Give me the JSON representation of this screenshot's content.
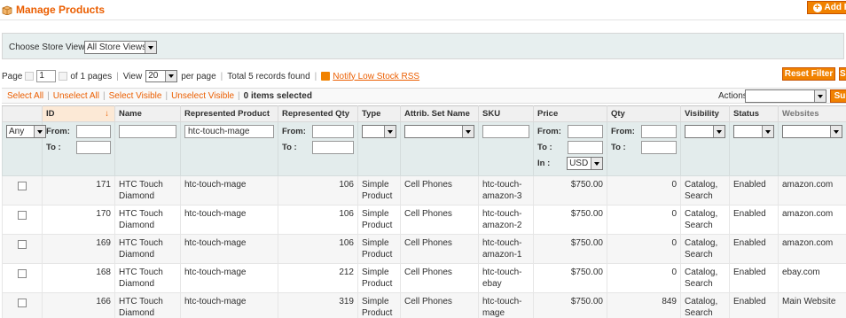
{
  "header": {
    "title": "Manage Products",
    "add_label": "Add P"
  },
  "store": {
    "label": "Choose Store View:",
    "selected": "All Store Views"
  },
  "pager": {
    "page_label": "Page",
    "page_value": "1",
    "of_pages": "of 1 pages",
    "view_label": "View",
    "per_page_value": "20",
    "per_page_label": "per page",
    "total": "Total 5 records found",
    "rss_label": "Notify Low Stock RSS",
    "reset_label": "Reset Filter",
    "search_label": "Se"
  },
  "mass": {
    "select_all": "Select All",
    "unselect_all": "Unselect All",
    "select_visible": "Select Visible",
    "unselect_visible": "Unselect Visible",
    "selected_count": "0 items selected",
    "actions_label": "Actions",
    "submit_label": "Su"
  },
  "columns": {
    "id": "ID",
    "name": "Name",
    "represented_product": "Represented Product",
    "represented_qty": "Represented Qty",
    "type": "Type",
    "attrib_set": "Attrib. Set Name",
    "sku": "SKU",
    "price": "Price",
    "qty": "Qty",
    "visibility": "Visibility",
    "status": "Status",
    "websites": "Websites"
  },
  "filters": {
    "any": "Any",
    "from": "From:",
    "to": "To :",
    "in": "In :",
    "represented_product_value": "htc-touch-mage",
    "currency": "USD"
  },
  "rows": [
    {
      "id": "171",
      "name": "HTC Touch Diamond",
      "rep_product": "htc-touch-mage",
      "rep_qty": "106",
      "type": "Simple Product",
      "attrib": "Cell Phones",
      "sku": "htc-touch-amazon-3",
      "price": "$750.00",
      "qty": "0",
      "visibility": "Catalog, Search",
      "status": "Enabled",
      "websites": "amazon.com"
    },
    {
      "id": "170",
      "name": "HTC Touch Diamond",
      "rep_product": "htc-touch-mage",
      "rep_qty": "106",
      "type": "Simple Product",
      "attrib": "Cell Phones",
      "sku": "htc-touch-amazon-2",
      "price": "$750.00",
      "qty": "0",
      "visibility": "Catalog, Search",
      "status": "Enabled",
      "websites": "amazon.com"
    },
    {
      "id": "169",
      "name": "HTC Touch Diamond",
      "rep_product": "htc-touch-mage",
      "rep_qty": "106",
      "type": "Simple Product",
      "attrib": "Cell Phones",
      "sku": "htc-touch-amazon-1",
      "price": "$750.00",
      "qty": "0",
      "visibility": "Catalog, Search",
      "status": "Enabled",
      "websites": "amazon.com"
    },
    {
      "id": "168",
      "name": "HTC Touch Diamond",
      "rep_product": "htc-touch-mage",
      "rep_qty": "212",
      "type": "Simple Product",
      "attrib": "Cell Phones",
      "sku": "htc-touch-ebay",
      "price": "$750.00",
      "qty": "0",
      "visibility": "Catalog, Search",
      "status": "Enabled",
      "websites": "ebay.com"
    },
    {
      "id": "166",
      "name": "HTC Touch Diamond",
      "rep_product": "htc-touch-mage",
      "rep_qty": "319",
      "type": "Simple Product",
      "attrib": "Cell Phones",
      "sku": "htc-touch-mage",
      "price": "$750.00",
      "qty": "849",
      "visibility": "Catalog, Search",
      "status": "Enabled",
      "websites": "Main Website"
    }
  ],
  "colors": {
    "accent": "#eb5e00",
    "button": "#f18200",
    "filter_bg": "#e3ecec",
    "sorted_header": "#fce9d6"
  }
}
